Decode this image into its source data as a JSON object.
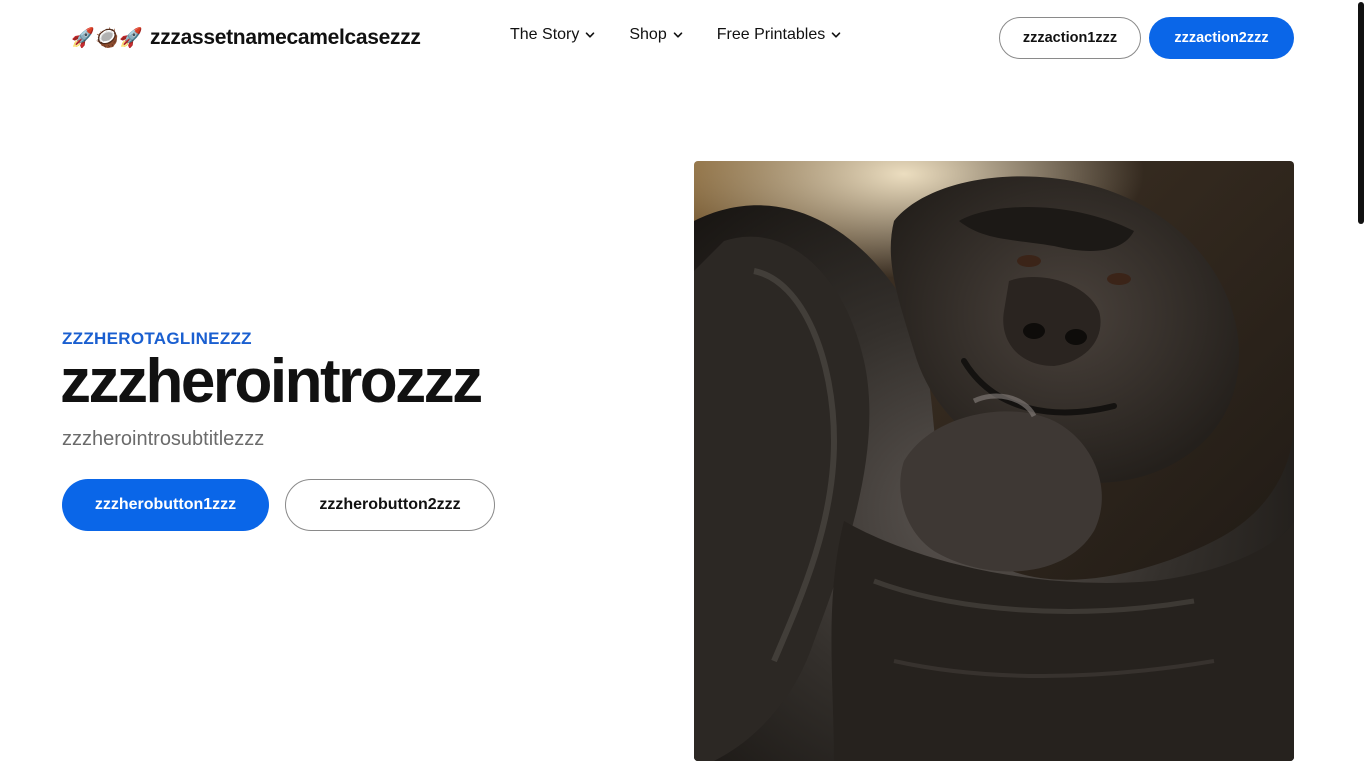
{
  "header": {
    "brand_name": "zzzassetnamecamelcasezzz",
    "brand_icons": [
      "rocket-icon",
      "coconut-icon",
      "rocket-icon"
    ],
    "nav": [
      {
        "label": "The Story",
        "icon": "chevron-down-icon"
      },
      {
        "label": "Shop",
        "icon": "chevron-down-icon"
      },
      {
        "label": "Free Printables",
        "icon": "chevron-down-icon"
      }
    ],
    "action1_label": "zzzaction1zzz",
    "action2_label": "zzzaction2zzz"
  },
  "hero": {
    "tagline": "ZZZHEROTAGLINEZZZ",
    "title": "zzzherointrozzz",
    "subtitle": "zzzherointrosubtitlezzz",
    "button1_label": "zzzherobutton1zzz",
    "button2_label": "zzzherobutton2zzz",
    "image_subject": "gorilla-photo"
  },
  "colors": {
    "accent": "#0a66e8",
    "tagline": "#1a5fd0",
    "text": "#111111",
    "muted": "#6b6b6b"
  }
}
